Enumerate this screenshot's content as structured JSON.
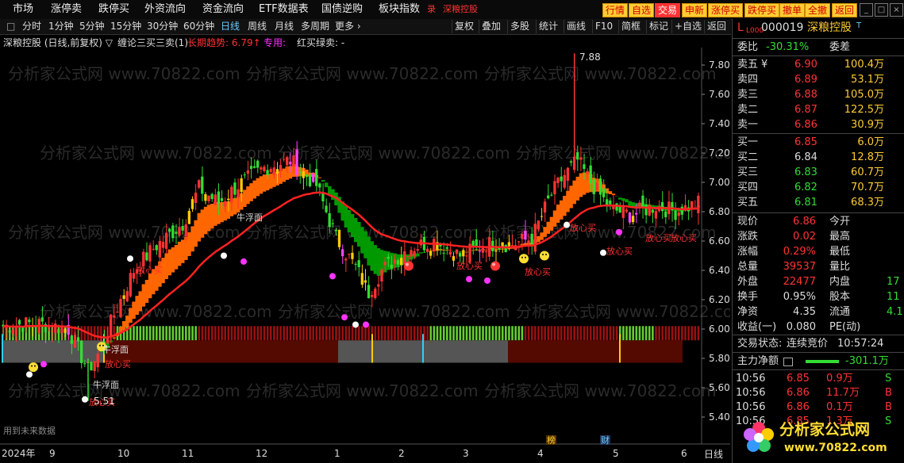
{
  "menu": [
    "市场",
    "涨停卖",
    "跌停买",
    "外资流向",
    "资金流向",
    "ETF数据表",
    "国债逆购",
    "板块指数",
    "录",
    "深粮控股"
  ],
  "toolbar_buttons": [
    "行情",
    "自选",
    "交易",
    "申新",
    "涨停买",
    "跌停买",
    "撤单",
    "全撤",
    "返回"
  ],
  "periods": [
    "分时",
    "1分钟",
    "5分钟",
    "15分钟",
    "30分钟",
    "60分钟",
    "日线",
    "周线",
    "月线",
    "多周期",
    "更多 ›"
  ],
  "tools": [
    "复权",
    "叠加",
    "多股",
    "统计",
    "画线",
    "F10",
    "简框",
    "标记",
    "+自选",
    "返回"
  ],
  "info": {
    "title": "深粮控股 (日线,前复权) ▽",
    "indicator": "缠论三买三卖(1)",
    "long_trend": "长期趋势: 6.79↑",
    "dedicated": "专用:",
    "redbuy": "红买绿卖: -"
  },
  "stock": {
    "prefix": "L",
    "sub": "L000",
    "code": "000019",
    "name": "深粮控股",
    "mark": "T"
  },
  "committee": {
    "ratio_label": "委比",
    "ratio": "-30.31%",
    "diff_label": "委差",
    "diff": ""
  },
  "asks": [
    {
      "label": "卖五",
      "price": "6.90",
      "vol": "100.4万",
      "mark": "¥"
    },
    {
      "label": "卖四",
      "price": "6.89",
      "vol": "53.1万"
    },
    {
      "label": "卖三",
      "price": "6.88",
      "vol": "105.0万"
    },
    {
      "label": "卖二",
      "price": "6.87",
      "vol": "122.5万"
    },
    {
      "label": "卖一",
      "price": "6.86",
      "vol": "30.9万"
    }
  ],
  "bids": [
    {
      "label": "买一",
      "price": "6.85",
      "vol": "6.0万"
    },
    {
      "label": "买二",
      "price": "6.84",
      "vol": "12.8万"
    },
    {
      "label": "买三",
      "price": "6.83",
      "vol": "60.7万"
    },
    {
      "label": "买四",
      "price": "6.82",
      "vol": "70.7万"
    },
    {
      "label": "买五",
      "price": "6.81",
      "vol": "68.3万"
    }
  ],
  "quote": [
    {
      "l1": "现价",
      "v1": "6.86",
      "l2": "今开",
      "v2": ""
    },
    {
      "l1": "涨跌",
      "v1": "0.02",
      "l2": "最高",
      "v2": ""
    },
    {
      "l1": "涨幅",
      "v1": "0.29%",
      "l2": "最低",
      "v2": ""
    },
    {
      "l1": "总量",
      "v1": "39537",
      "l2": "量比",
      "v2": ""
    },
    {
      "l1": "外盘",
      "v1": "22477",
      "l2": "内盘",
      "v2": "17"
    },
    {
      "l1": "换手",
      "v1": "0.95%",
      "l2": "股本",
      "v2": "11"
    },
    {
      "l1": "净资",
      "v1": "4.35",
      "l2": "流通",
      "v2": "4.1"
    },
    {
      "l1": "收益(一)",
      "v1": "0.080",
      "l2": "PE(动)",
      "v2": ""
    }
  ],
  "trade_state": {
    "label": "交易状态:",
    "value": "连续竞价",
    "time": "10:57:24"
  },
  "main_flow": {
    "label": "主力净额",
    "value": "-301.1万"
  },
  "ticks": [
    {
      "time": "10:56",
      "price": "6.85",
      "vol": "0.9万",
      "side": "S"
    },
    {
      "time": "10:56",
      "price": "6.86",
      "vol": "11.7万",
      "side": "B"
    },
    {
      "time": "10:56",
      "price": "6.86",
      "vol": "0.1万",
      "side": "B"
    },
    {
      "time": "10:56",
      "price": "6.85",
      "vol": "1.3万",
      "side": "S"
    }
  ],
  "chart_data": {
    "type": "candlestick",
    "y_ticks": [
      "7.80",
      "7.60",
      "7.40",
      "7.20",
      "7.00",
      "6.80",
      "6.60",
      "6.40",
      "6.20",
      "6.00",
      "5.80",
      "5.60",
      "5.40"
    ],
    "x_labels": [
      "2024年",
      "9",
      "10",
      "11",
      "12",
      "1",
      "2",
      "3",
      "4",
      "5",
      "6"
    ],
    "period_label": "日线",
    "high_label": "7.88",
    "low_label": "5.51",
    "annotations": [
      "牛浮面",
      "放心买",
      "牛浮面",
      "牛浮面",
      "放心买",
      "放心买",
      "放心买",
      "放心买",
      "放心买",
      "放心买",
      "放心买",
      "放心买"
    ],
    "future_note": "用到未来数据",
    "events": [
      "榜",
      "财"
    ],
    "watermark": "分析家公式网 www.70822.com"
  },
  "logo": {
    "text": "分析家公式网",
    "url": "www.70822.com"
  },
  "colors": {
    "up": "#ff3333",
    "down": "#33dd33",
    "accent": "#ffcc33"
  }
}
